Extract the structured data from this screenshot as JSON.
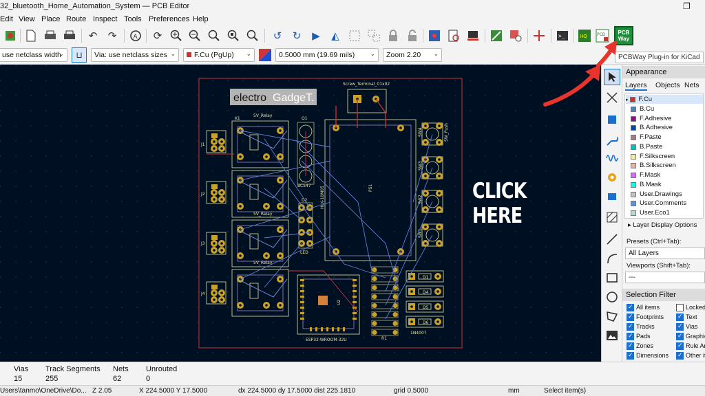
{
  "window": {
    "title": "32_bluetooth_Home_Automation_System — PCB Editor",
    "restore_glyph": "❐"
  },
  "menu": [
    "Edit",
    "View",
    "Place",
    "Route",
    "Inspect",
    "Tools",
    "Preferences",
    "Help"
  ],
  "toolbar2": {
    "track_width": "use netclass width",
    "via_size": "Via: use netclass sizes",
    "layer": "F.Cu (PgUp)",
    "grid": "0.5000 mm (19.69 mils)",
    "zoom": "Zoom 2.20"
  },
  "pcbway_tooltip": "PCBWay Plug-in for KiCad",
  "pcbway_button": {
    "line1": "PCB",
    "line2": "Way"
  },
  "callout": "CLICK HERE",
  "board": {
    "logo_a": "electro",
    "logo_b": "GadgeT.",
    "connector": "Screw_Terminal_01x02",
    "relay": "5V_Relay",
    "transistor": "BC547",
    "module": "HLK-10M05",
    "module_ref": "PS1",
    "mcu": "ESP32-WROOM-32U",
    "mcu_ref": "U2",
    "diode": "1N4007",
    "switch": "SW_Push",
    "led": "LED",
    "relay_refs": [
      "K1",
      "K2",
      "K3",
      "K4"
    ],
    "conn_refs": [
      "J1",
      "J2",
      "J3",
      "J4"
    ],
    "switch_refs": [
      "SW4",
      "SW3",
      "SW2",
      "SW1"
    ],
    "diode_refs": [
      "D1",
      "D4",
      "D5",
      "D6"
    ],
    "q_ref": "Q1",
    "led_ref": "D2",
    "res_ref": "R1"
  },
  "appearance": {
    "title": "Appearance",
    "tabs": [
      "Layers",
      "Objects",
      "Nets"
    ],
    "layers": [
      {
        "name": "F.Cu",
        "color": "#c83434"
      },
      {
        "name": "B.Cu",
        "color": "#4d7fc4"
      },
      {
        "name": "F.Adhesive",
        "color": "#841384"
      },
      {
        "name": "B.Adhesive",
        "color": "#0047b3"
      },
      {
        "name": "F.Paste",
        "color": "#a08080"
      },
      {
        "name": "B.Paste",
        "color": "#00c2c2"
      },
      {
        "name": "F.Silkscreen",
        "color": "#f2eda1"
      },
      {
        "name": "B.Silkscreen",
        "color": "#e8b2a7"
      },
      {
        "name": "F.Mask",
        "color": "#d864ff"
      },
      {
        "name": "B.Mask",
        "color": "#02ffee"
      },
      {
        "name": "User.Drawings",
        "color": "#c2c2c2"
      },
      {
        "name": "User.Comments",
        "color": "#5994dc"
      },
      {
        "name": "User.Eco1",
        "color": "#b4dbd2"
      }
    ],
    "layer_display_options": "Layer Display Options",
    "presets_label": "Presets (Ctrl+Tab):",
    "presets_value": "All Layers",
    "viewports_label": "Viewports (Shift+Tab):",
    "viewports_value": "---"
  },
  "selection_filter": {
    "title": "Selection Filter",
    "items": [
      {
        "label": "All items",
        "checked": true
      },
      {
        "label": "Locked",
        "checked": false
      },
      {
        "label": "Footprints",
        "checked": true
      },
      {
        "label": "Text",
        "checked": true
      },
      {
        "label": "Tracks",
        "checked": true
      },
      {
        "label": "Vias",
        "checked": true
      },
      {
        "label": "Pads",
        "checked": true
      },
      {
        "label": "Graphic",
        "checked": true
      },
      {
        "label": "Zones",
        "checked": true
      },
      {
        "label": "Rule Ar",
        "checked": true
      },
      {
        "label": "Dimensions",
        "checked": true
      },
      {
        "label": "Other it",
        "checked": true
      }
    ]
  },
  "messages": {
    "headers": [
      "Vias",
      "Track Segments",
      "Nets",
      "Unrouted"
    ],
    "values": [
      "15",
      "255",
      "62",
      "0"
    ]
  },
  "status": {
    "path": "Users\\tanmo\\OneDrive\\Do...",
    "zoom": "Z 2.05",
    "xy": "X 224.5000  Y 17.5000",
    "delta": "dx 224.5000  dy 17.5000  dist 225.1810",
    "grid": "grid 0.5000",
    "units": "mm",
    "mode": "Select item(s)"
  }
}
